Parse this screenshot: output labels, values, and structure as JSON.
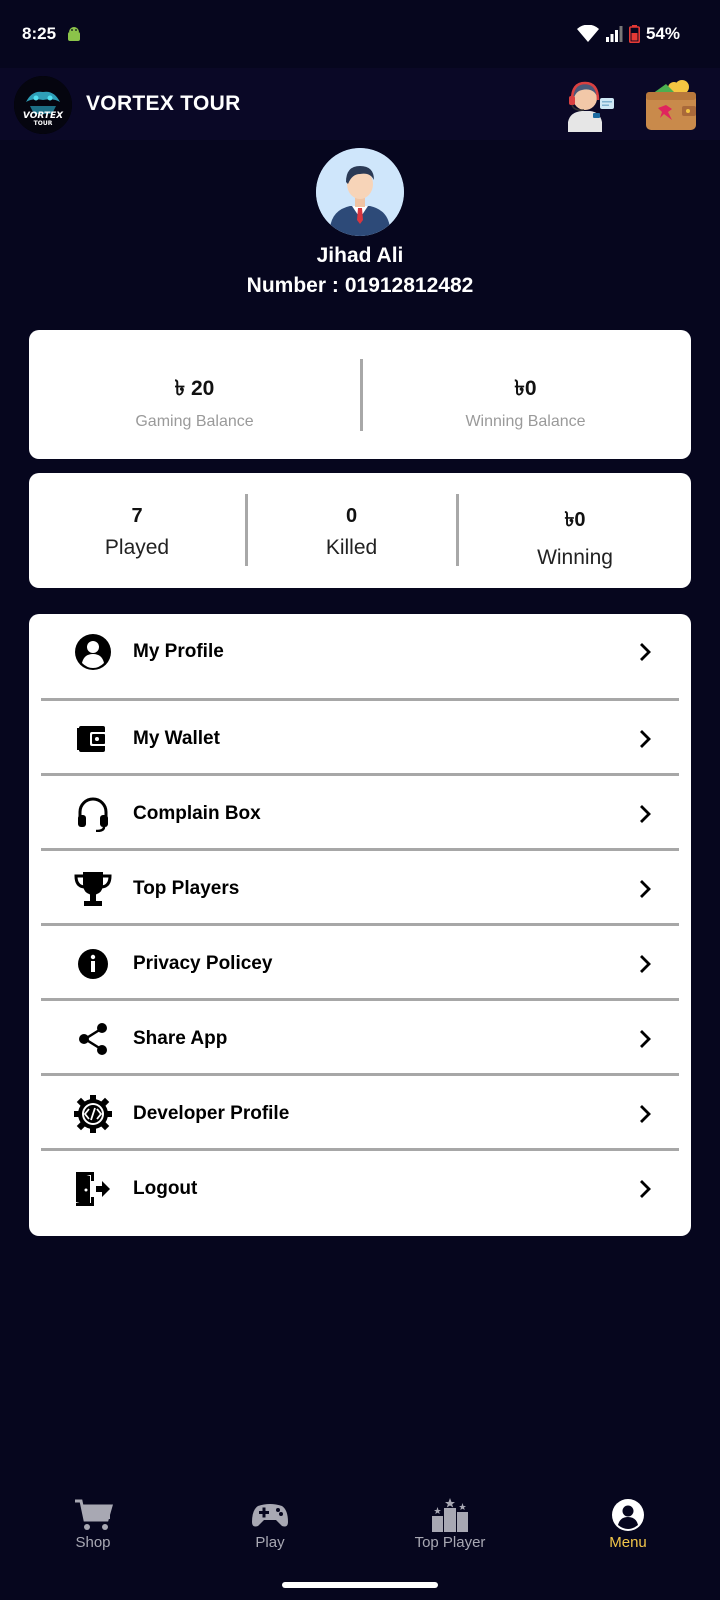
{
  "status_bar": {
    "time": "8:25",
    "battery": "54%",
    "icons": [
      "android-debug-icon",
      "wifi-icon",
      "signal-icon",
      "battery-icon"
    ]
  },
  "app_bar": {
    "title": "VORTEX TOUR",
    "logo_text": "VORTEX TOUR",
    "actions": [
      "support-agent-icon",
      "wallet-icon"
    ]
  },
  "profile": {
    "name": "Jihad Ali",
    "number_label": "Number :",
    "number": "01912812482"
  },
  "balances": {
    "gaming_value": "৳ 20",
    "gaming_label": "Gaming Balance",
    "winning_value": "৳0",
    "winning_label": "Winning Balance"
  },
  "stats": {
    "played_value": "7",
    "played_label": "Played",
    "killed_value": "0",
    "killed_label": "Killed",
    "winning_value": "৳0",
    "winning_label": "Winning"
  },
  "menu": {
    "items": [
      {
        "label": "My Profile",
        "icon": "account-circle-icon"
      },
      {
        "label": "My Wallet",
        "icon": "wallet-icon"
      },
      {
        "label": "Complain Box",
        "icon": "headset-icon"
      },
      {
        "label": "Top Players",
        "icon": "trophy-icon"
      },
      {
        "label": "Privacy Policey",
        "icon": "info-icon"
      },
      {
        "label": "Share App",
        "icon": "share-icon"
      },
      {
        "label": "Developer Profile",
        "icon": "developer-gear-icon"
      },
      {
        "label": "Logout",
        "icon": "logout-icon"
      }
    ]
  },
  "bottom_nav": {
    "items": [
      {
        "label": "Shop",
        "icon": "cart-icon",
        "active": false
      },
      {
        "label": "Play",
        "icon": "gamepad-icon",
        "active": false
      },
      {
        "label": "Top Player",
        "icon": "leaderboard-icon",
        "active": false
      },
      {
        "label": "Menu",
        "icon": "account-circle-icon",
        "active": true
      }
    ]
  },
  "colors": {
    "background": "#06061e",
    "app_bar": "#0a0826",
    "card": "#ffffff",
    "active_nav": "#f2c64a",
    "inactive_nav": "#a8a8b3"
  }
}
